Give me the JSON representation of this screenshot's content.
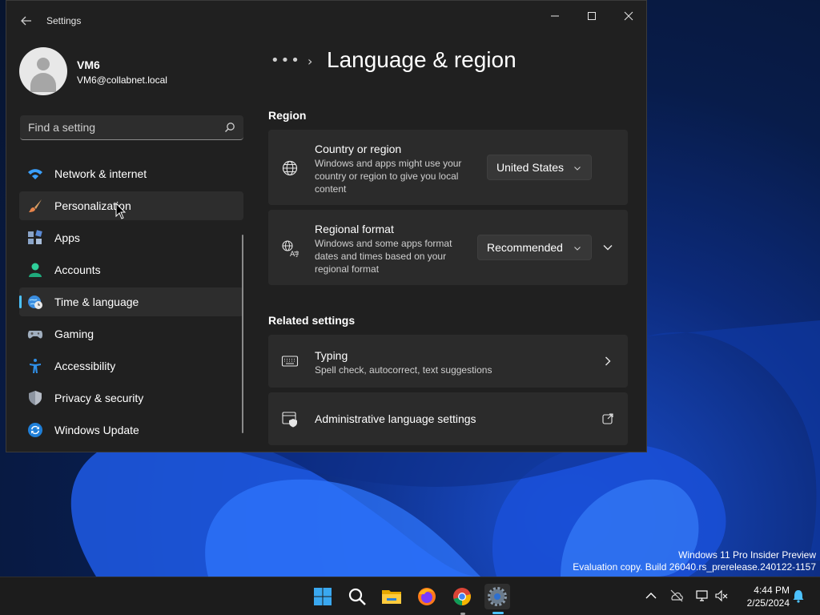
{
  "window": {
    "app_title": "Settings",
    "back_icon": "back-arrow-icon",
    "controls": [
      "minimize",
      "maximize",
      "close"
    ]
  },
  "profile": {
    "name": "VM6",
    "email": "VM6@collabnet.local"
  },
  "search": {
    "placeholder": "Find a setting"
  },
  "sidebar": {
    "items": [
      {
        "label": "Network & internet",
        "icon": "wifi-icon",
        "state": "normal"
      },
      {
        "label": "Personalization",
        "icon": "paintbrush-icon",
        "state": "hover"
      },
      {
        "label": "Apps",
        "icon": "apps-icon",
        "state": "normal"
      },
      {
        "label": "Accounts",
        "icon": "person-icon",
        "state": "normal"
      },
      {
        "label": "Time & language",
        "icon": "globe-clock-icon",
        "state": "active"
      },
      {
        "label": "Gaming",
        "icon": "gamepad-icon",
        "state": "normal"
      },
      {
        "label": "Accessibility",
        "icon": "accessibility-icon",
        "state": "normal"
      },
      {
        "label": "Privacy & security",
        "icon": "shield-icon",
        "state": "normal"
      },
      {
        "label": "Windows Update",
        "icon": "update-icon",
        "state": "normal"
      }
    ]
  },
  "main": {
    "breadcrumb_more": "•••",
    "breadcrumb_sep": "›",
    "page_title": "Language & region",
    "region_section": "Region",
    "country": {
      "title": "Country or region",
      "desc": "Windows and apps might use your country or region to give you local content",
      "value": "United States"
    },
    "regional_format": {
      "title": "Regional format",
      "desc": "Windows and some apps format dates and times based on your regional format",
      "value": "Recommended"
    },
    "related_section": "Related settings",
    "typing": {
      "title": "Typing",
      "desc": "Spell check, autocorrect, text suggestions"
    },
    "admin_lang": {
      "title": "Administrative language settings"
    }
  },
  "desktop": {
    "watermark_line1": "Windows 11 Pro Insider Preview",
    "watermark_line2": "Evaluation copy. Build 26040.rs_prerelease.240122-1157"
  },
  "taskbar": {
    "apps": [
      "start-icon",
      "search-icon",
      "file-explorer-icon",
      "firefox-icon",
      "chrome-icon",
      "settings-icon"
    ],
    "time": "4:44 PM",
    "date": "2/25/2024"
  },
  "colors": {
    "accent": "#4cc2ff",
    "window_bg": "#202020",
    "card_bg": "#2b2b2b"
  }
}
